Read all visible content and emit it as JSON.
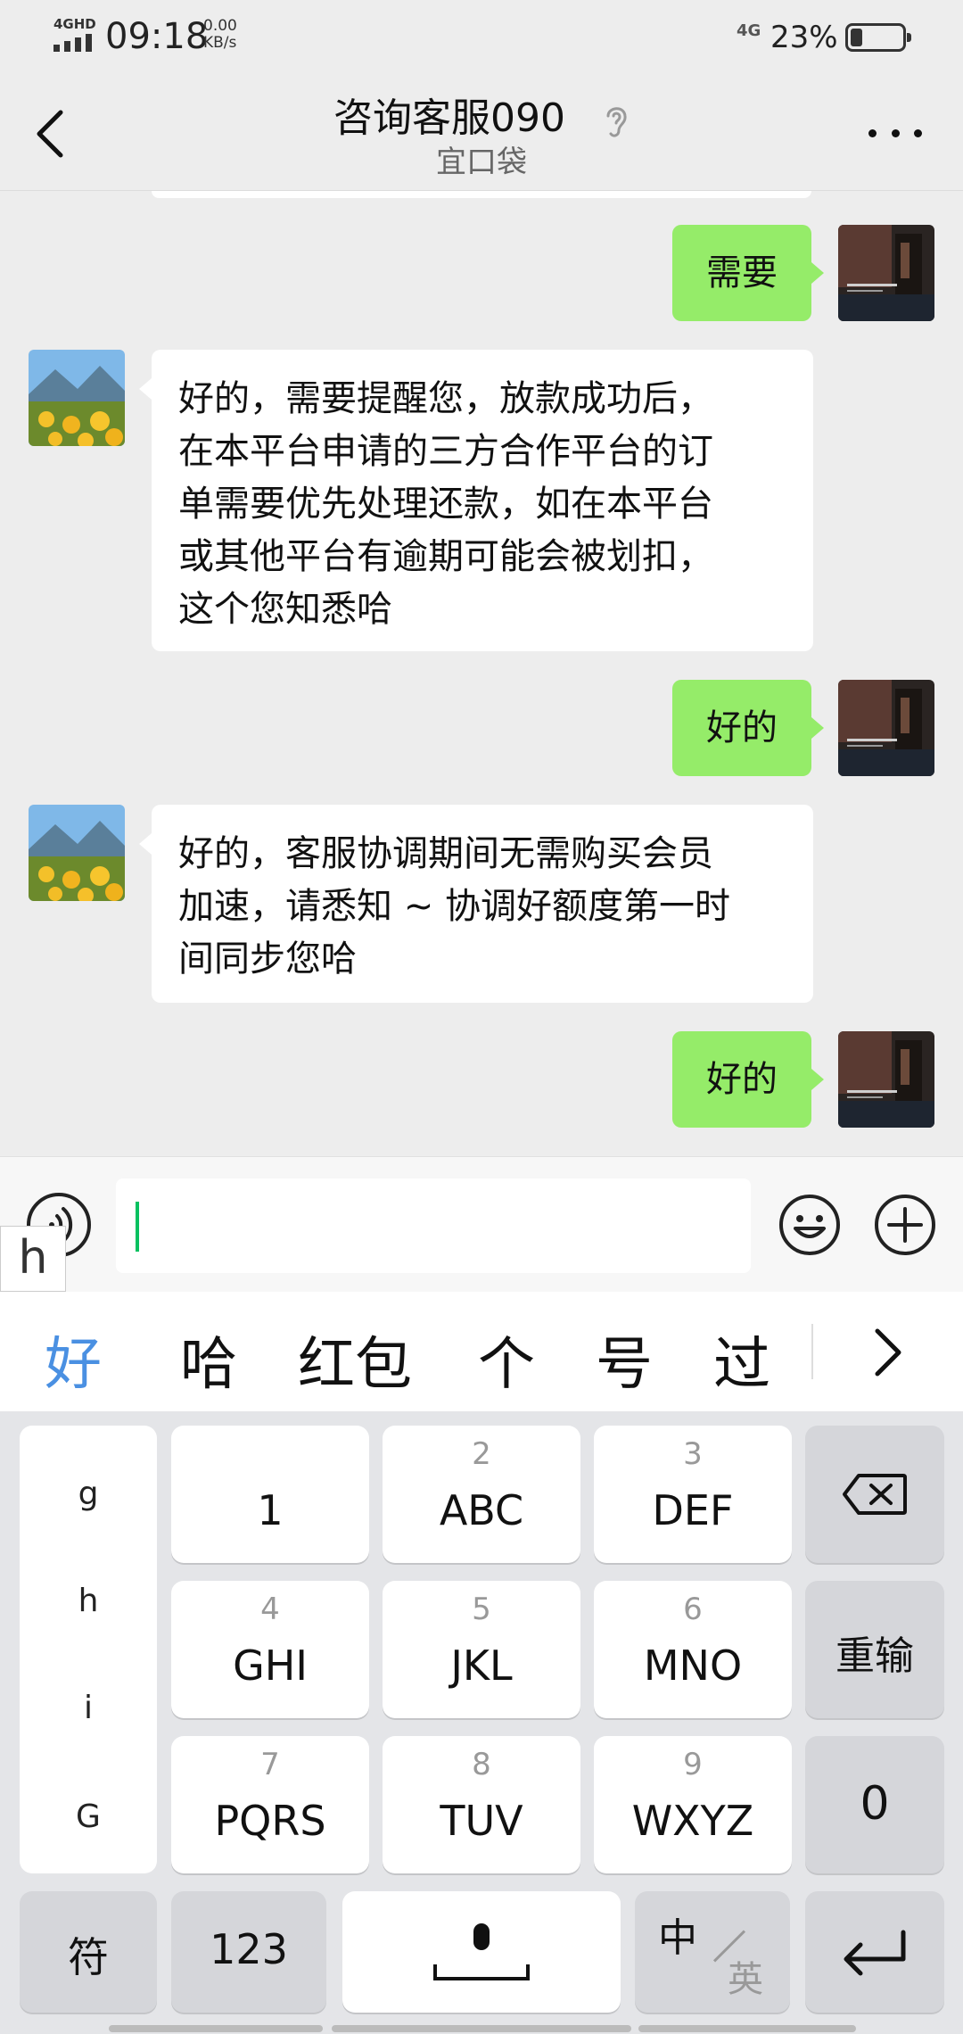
{
  "status_bar": {
    "network_type": "4GHD",
    "time": "09:18",
    "speed_value": "0.00",
    "speed_unit": "KB/s",
    "right_network": "4G",
    "battery": "23%",
    "battery_level": 0.23
  },
  "header": {
    "title": "咨询客服090",
    "subtitle": "宜口袋",
    "back_icon": "chevron-left-icon",
    "more_icon": "more-icon",
    "listen_icon": "ear-icon"
  },
  "messages": [
    {
      "side": "out",
      "text": "需要"
    },
    {
      "side": "in",
      "lines": [
        "好的，需要提醒您，放款成功后，",
        "在本平台申请的三方合作平台的订",
        "单需要优先处理还款，如在本平台",
        "或其他平台有逾期可能会被划扣，",
        "这个您知悉哈"
      ]
    },
    {
      "side": "out",
      "text": "好的"
    },
    {
      "side": "in",
      "lines": [
        "好的，客服协调期间无需购买会员",
        "加速，请悉知 ~ 协调好额度第一时",
        "间同步您哈"
      ]
    },
    {
      "side": "out",
      "text": "好的"
    }
  ],
  "input": {
    "value": "",
    "pinyin_composing": "h"
  },
  "candidates": [
    "好",
    "哈",
    "红包",
    "个",
    "号",
    "过"
  ],
  "keyboard": {
    "side_letters": [
      "g",
      "h",
      "i",
      "G"
    ],
    "keys": [
      {
        "num": "",
        "letters": "1"
      },
      {
        "num": "2",
        "letters": "ABC"
      },
      {
        "num": "3",
        "letters": "DEF"
      },
      {
        "num": "4",
        "letters": "GHI"
      },
      {
        "num": "5",
        "letters": "JKL"
      },
      {
        "num": "6",
        "letters": "MNO"
      },
      {
        "num": "7",
        "letters": "PQRS"
      },
      {
        "num": "8",
        "letters": "TUV"
      },
      {
        "num": "9",
        "letters": "WXYZ"
      }
    ],
    "reset_label": "重输",
    "zero_label": "0",
    "symbol_label": "符",
    "numeric_label": "123",
    "lang_zh": "中",
    "lang_en": "英"
  },
  "colors": {
    "outgoing_bubble": "#95ec69",
    "incoming_bubble": "#ffffff",
    "candidate_highlight": "#4a90e2",
    "caret": "#07c160"
  }
}
